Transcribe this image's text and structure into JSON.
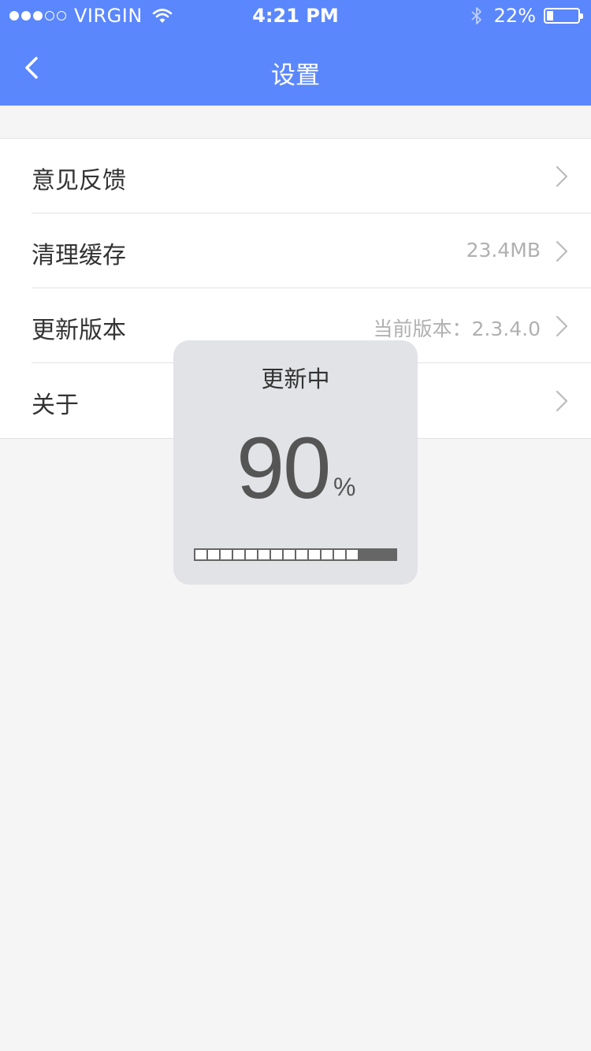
{
  "status_bar": {
    "carrier": "VIRGIN",
    "time": "4:21 PM",
    "battery_percent": "22%",
    "battery_level": 0.22,
    "signal_strength_dots": 3,
    "signal_total_dots": 5
  },
  "header": {
    "title": "设置",
    "back_icon": "chevron-left-icon",
    "background_color": "#5b87fd"
  },
  "settings": {
    "items": [
      {
        "label": "意见反馈",
        "value": ""
      },
      {
        "label": "清理缓存",
        "value": "23.4MB"
      },
      {
        "label": "更新版本",
        "value": "当前版本：2.3.4.0"
      },
      {
        "label": "关于",
        "value": ""
      }
    ]
  },
  "update_dialog": {
    "title": "更新中",
    "percent": "90",
    "unit": "%",
    "progress": 0.9
  }
}
